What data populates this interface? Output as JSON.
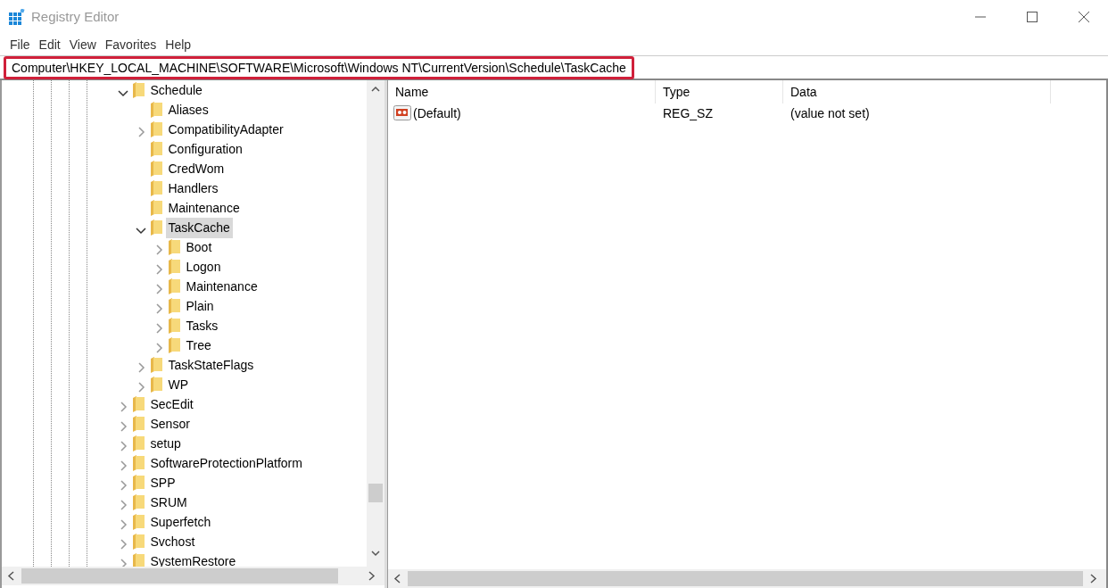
{
  "window": {
    "title": "Registry Editor"
  },
  "menu": [
    "File",
    "Edit",
    "View",
    "Favorites",
    "Help"
  ],
  "address_bar": {
    "value": "Computer\\HKEY_LOCAL_MACHINE\\SOFTWARE\\Microsoft\\Windows NT\\CurrentVersion\\Schedule\\TaskCache",
    "highlighted": true
  },
  "tree": [
    {
      "label": "Schedule",
      "expanded": true,
      "selected": false,
      "children": [
        {
          "label": "Aliases",
          "selected": false
        },
        {
          "label": "CompatibilityAdapter",
          "expanded": false,
          "selected": false
        },
        {
          "label": "Configuration",
          "selected": false
        },
        {
          "label": "CredWom",
          "selected": false
        },
        {
          "label": "Handlers",
          "selected": false
        },
        {
          "label": "Maintenance",
          "selected": false
        },
        {
          "label": "TaskCache",
          "expanded": true,
          "selected": true,
          "children": [
            {
              "label": "Boot",
              "expanded": false,
              "selected": false
            },
            {
              "label": "Logon",
              "expanded": false,
              "selected": false
            },
            {
              "label": "Maintenance",
              "expanded": false,
              "selected": false
            },
            {
              "label": "Plain",
              "expanded": false,
              "selected": false
            },
            {
              "label": "Tasks",
              "expanded": false,
              "selected": false
            },
            {
              "label": "Tree",
              "expanded": false,
              "selected": false
            }
          ]
        },
        {
          "label": "TaskStateFlags",
          "expanded": false,
          "selected": false
        },
        {
          "label": "WP",
          "expanded": false,
          "selected": false
        }
      ]
    },
    {
      "label": "SecEdit",
      "expanded": false,
      "selected": false
    },
    {
      "label": "Sensor",
      "expanded": false,
      "selected": false
    },
    {
      "label": "setup",
      "expanded": false,
      "selected": false
    },
    {
      "label": "SoftwareProtectionPlatform",
      "expanded": false,
      "selected": false
    },
    {
      "label": "SPP",
      "expanded": false,
      "selected": false
    },
    {
      "label": "SRUM",
      "expanded": false,
      "selected": false
    },
    {
      "label": "Superfetch",
      "expanded": false,
      "selected": false
    },
    {
      "label": "Svchost",
      "expanded": false,
      "selected": false
    },
    {
      "label": "SystemRestore",
      "expanded": false,
      "selected": false
    }
  ],
  "values": {
    "columns": [
      "Name",
      "Type",
      "Data"
    ],
    "rows": [
      {
        "name": "(Default)",
        "type": "REG_SZ",
        "data": "(value not set)"
      }
    ]
  }
}
